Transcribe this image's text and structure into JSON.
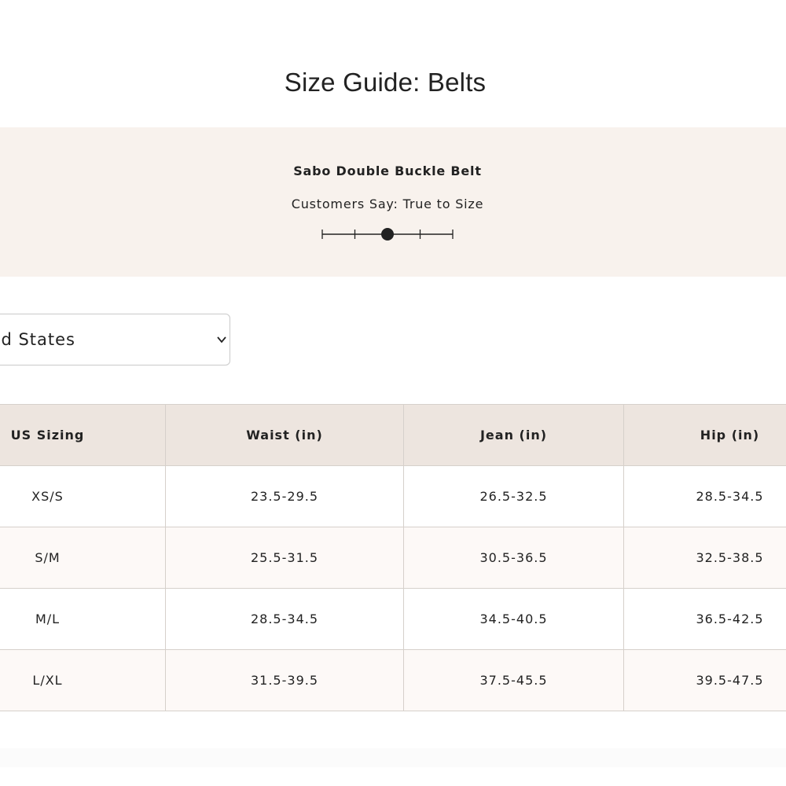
{
  "title": "Size Guide: Belts",
  "fit": {
    "product_name": "Sabo Double Buckle Belt",
    "label": "Customers Say: True to Size",
    "scale_position": 0.5,
    "scale_steps": 5
  },
  "region_select": {
    "value": "United States",
    "icon": "chevron-down-icon"
  },
  "table": {
    "headers": [
      "US Sizing",
      "Waist (in)",
      "Jean (in)",
      "Hip (in)"
    ],
    "rows": [
      [
        "XS/S",
        "23.5-29.5",
        "26.5-32.5",
        "28.5-34.5"
      ],
      [
        "S/M",
        "25.5-31.5",
        "30.5-36.5",
        "32.5-38.5"
      ],
      [
        "M/L",
        "28.5-34.5",
        "34.5-40.5",
        "36.5-42.5"
      ],
      [
        "L/XL",
        "31.5-39.5",
        "37.5-45.5",
        "39.5-47.5"
      ]
    ]
  },
  "colors": {
    "panel_background": "#f8f2ed",
    "header_background": "#ede5df",
    "alt_row_background": "#fdf9f7",
    "text": "#222222"
  }
}
